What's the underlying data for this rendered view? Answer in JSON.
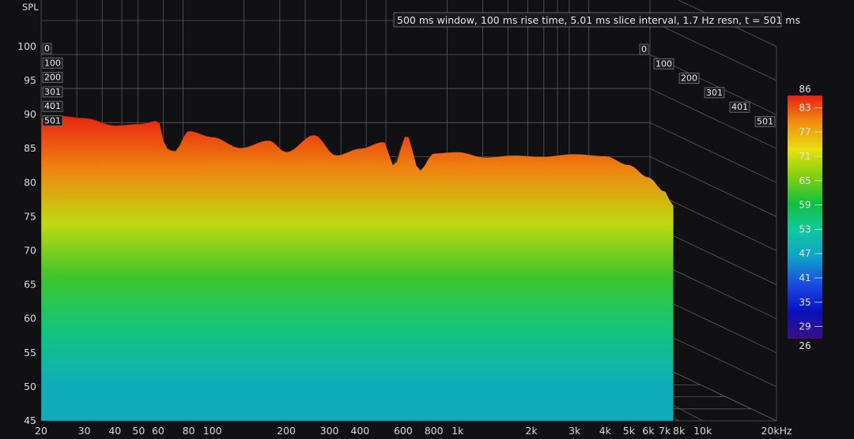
{
  "header": {
    "y_axis_title": "SPL",
    "info": "500 ms window, 100 ms rise time, 5.01 ms slice interval, 1.7 Hz resn, t = 501 ms"
  },
  "chart_data": {
    "type": "waterfall",
    "ylabel": "SPL",
    "xlabel": "",
    "x_scale": "log",
    "xlim": [
      20,
      20000
    ],
    "ylim": [
      45,
      100
    ],
    "y_ticks": [
      45,
      50,
      55,
      60,
      65,
      70,
      75,
      80,
      85,
      90,
      95,
      100
    ],
    "x_ticks": [
      {
        "v": 20,
        "label": "20"
      },
      {
        "v": 30,
        "label": "30"
      },
      {
        "v": 40,
        "label": "40"
      },
      {
        "v": 50,
        "label": "50"
      },
      {
        "v": 60,
        "label": "60"
      },
      {
        "v": 80,
        "label": "80"
      },
      {
        "v": 100,
        "label": "100"
      },
      {
        "v": 200,
        "label": "200"
      },
      {
        "v": 300,
        "label": "300"
      },
      {
        "v": 400,
        "label": "400"
      },
      {
        "v": 600,
        "label": "600"
      },
      {
        "v": 800,
        "label": "800"
      },
      {
        "v": 1000,
        "label": "1k"
      },
      {
        "v": 2000,
        "label": "2k"
      },
      {
        "v": 3000,
        "label": "3k"
      },
      {
        "v": 4000,
        "label": "4k"
      },
      {
        "v": 5000,
        "label": "5k"
      },
      {
        "v": 6000,
        "label": "6k"
      },
      {
        "v": 7000,
        "label": "7k"
      },
      {
        "v": 8000,
        "label": "8k"
      },
      {
        "v": 10000,
        "label": "10k"
      },
      {
        "v": 20000,
        "label": "20kHz"
      }
    ],
    "slice_times_ms": [
      "0",
      "100",
      "200",
      "301",
      "401",
      "501"
    ],
    "colorbar": {
      "range": [
        26,
        86
      ],
      "ticks": [
        83,
        77,
        71,
        65,
        59,
        53,
        47,
        41,
        35,
        29
      ],
      "top_label": "86",
      "bottom_label": "26",
      "colors": [
        "#3a1080",
        "#0a10c0",
        "#1a4ae0",
        "#10a0c8",
        "#10c8a0",
        "#10c040",
        "#80d010",
        "#e8e010",
        "#f09010",
        "#e82010"
      ]
    },
    "front_slice_response_db": [
      {
        "f": 20,
        "db": 89.5
      },
      {
        "f": 24,
        "db": 89.8
      },
      {
        "f": 30,
        "db": 89.5
      },
      {
        "f": 40,
        "db": 88.4
      },
      {
        "f": 50,
        "db": 88.6
      },
      {
        "f": 60,
        "db": 89.1
      },
      {
        "f": 65,
        "db": 85.0
      },
      {
        "f": 70,
        "db": 84.6
      },
      {
        "f": 80,
        "db": 87.6
      },
      {
        "f": 100,
        "db": 86.7
      },
      {
        "f": 130,
        "db": 85.1
      },
      {
        "f": 170,
        "db": 86.2
      },
      {
        "f": 200,
        "db": 84.5
      },
      {
        "f": 260,
        "db": 87.0
      },
      {
        "f": 320,
        "db": 84.0
      },
      {
        "f": 400,
        "db": 85.0
      },
      {
        "f": 500,
        "db": 86.0
      },
      {
        "f": 550,
        "db": 82.5
      },
      {
        "f": 620,
        "db": 87.0
      },
      {
        "f": 700,
        "db": 81.8
      },
      {
        "f": 800,
        "db": 84.3
      },
      {
        "f": 1000,
        "db": 84.5
      },
      {
        "f": 1300,
        "db": 83.7
      },
      {
        "f": 1700,
        "db": 84.0
      },
      {
        "f": 2200,
        "db": 83.8
      },
      {
        "f": 3000,
        "db": 84.2
      },
      {
        "f": 4000,
        "db": 83.9
      },
      {
        "f": 5000,
        "db": 82.6
      },
      {
        "f": 6000,
        "db": 80.8
      },
      {
        "f": 7000,
        "db": 78.7
      },
      {
        "f": 7600,
        "db": 76.6
      }
    ]
  }
}
